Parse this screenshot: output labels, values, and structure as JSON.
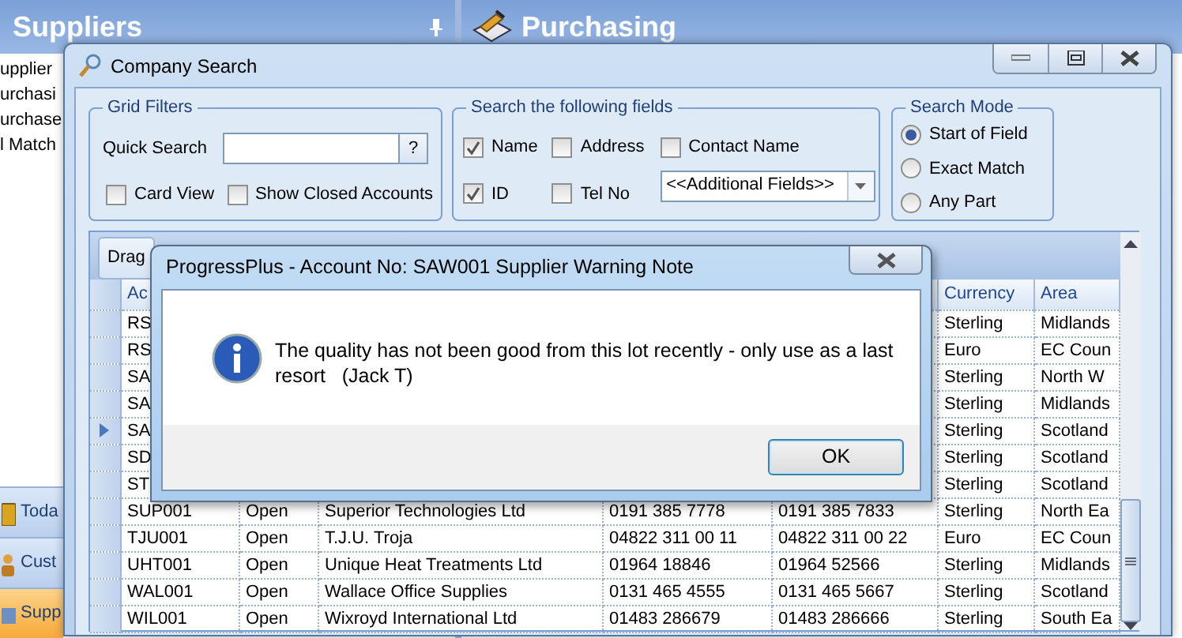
{
  "app": {
    "left_panel": {
      "title": "Suppliers",
      "items": [
        "upplier",
        "urchasi",
        "urchase",
        "l Match"
      ]
    },
    "right_panel": {
      "title": "Purchasing"
    },
    "nav": [
      {
        "label": "Toda",
        "selected": false
      },
      {
        "label": "Cust",
        "selected": false
      },
      {
        "label": "Supp",
        "selected": true
      }
    ]
  },
  "search_window": {
    "title": "Company Search",
    "grid_filters": {
      "title": "Grid Filters",
      "quick_search_label": "Quick Search",
      "help_button": "?",
      "checks": [
        {
          "label": "Card View",
          "checked": false
        },
        {
          "label": "Show Closed Accounts",
          "checked": false
        }
      ]
    },
    "search_fields": {
      "title": "Search the following fields",
      "checks": [
        {
          "label": "Name",
          "checked": true
        },
        {
          "label": "Address",
          "checked": false
        },
        {
          "label": "Contact Name",
          "checked": false
        },
        {
          "label": "ID",
          "checked": true
        },
        {
          "label": "Tel No",
          "checked": false
        }
      ],
      "additional_fields": "<<Additional Fields>>"
    },
    "search_mode": {
      "title": "Search Mode",
      "options": [
        {
          "label": "Start of Field",
          "selected": true
        },
        {
          "label": "Exact Match",
          "selected": false
        },
        {
          "label": "Any Part",
          "selected": false
        }
      ]
    },
    "grid": {
      "group_panel": "Drag",
      "headers": {
        "account": "Ac",
        "currency": "Currency",
        "area": "Area"
      },
      "rows": [
        {
          "account": "RS",
          "currency": "Sterling",
          "area": "Midlands",
          "current": false
        },
        {
          "account": "RS",
          "currency": "Euro",
          "area": "EC Coun",
          "current": false
        },
        {
          "account": "SA",
          "currency": "Sterling",
          "area": "North W",
          "current": false
        },
        {
          "account": "SA",
          "currency": "Sterling",
          "area": "Midlands",
          "current": false
        },
        {
          "account": "SA",
          "currency": "Sterling",
          "area": "Scotland",
          "current": true
        },
        {
          "account": "SD",
          "currency": "Sterling",
          "area": "Scotland",
          "current": false
        },
        {
          "account": "ST",
          "currency": "Sterling",
          "area": "Scotland",
          "current": false
        },
        {
          "account": "SUP001",
          "status": "Open",
          "name": "Superior Technologies Ltd",
          "tel": "0191 385 7778",
          "fax": "0191 385 7833",
          "currency": "Sterling",
          "area": "North Ea",
          "current": false
        },
        {
          "account": "TJU001",
          "status": "Open",
          "name": "T.J.U. Troja",
          "tel": "04822  311 00 11",
          "fax": "04822  311 00 22",
          "currency": "Euro",
          "area": "EC Coun",
          "current": false
        },
        {
          "account": "UHT001",
          "status": "Open",
          "name": "Unique Heat Treatments Ltd",
          "tel": "01964 18846",
          "fax": "01964 52566",
          "currency": "Sterling",
          "area": "Midlands",
          "current": false
        },
        {
          "account": "WAL001",
          "status": "Open",
          "name": "Wallace Office Supplies",
          "tel": "0131 465 4555",
          "fax": "0131 465 5667",
          "currency": "Sterling",
          "area": "Scotland",
          "current": false
        },
        {
          "account": "WIL001",
          "status": "Open",
          "name": "Wixroyd International Ltd",
          "tel": "01483 286679",
          "fax": "01483 286666",
          "currency": "Sterling",
          "area": "South Ea",
          "current": false
        }
      ]
    }
  },
  "warning_dialog": {
    "title": "ProgressPlus - Account No: SAW001 Supplier Warning Note",
    "message": "The quality has not been good from this lot recently - only use as a last resort   (Jack T)",
    "ok_button": "OK"
  }
}
